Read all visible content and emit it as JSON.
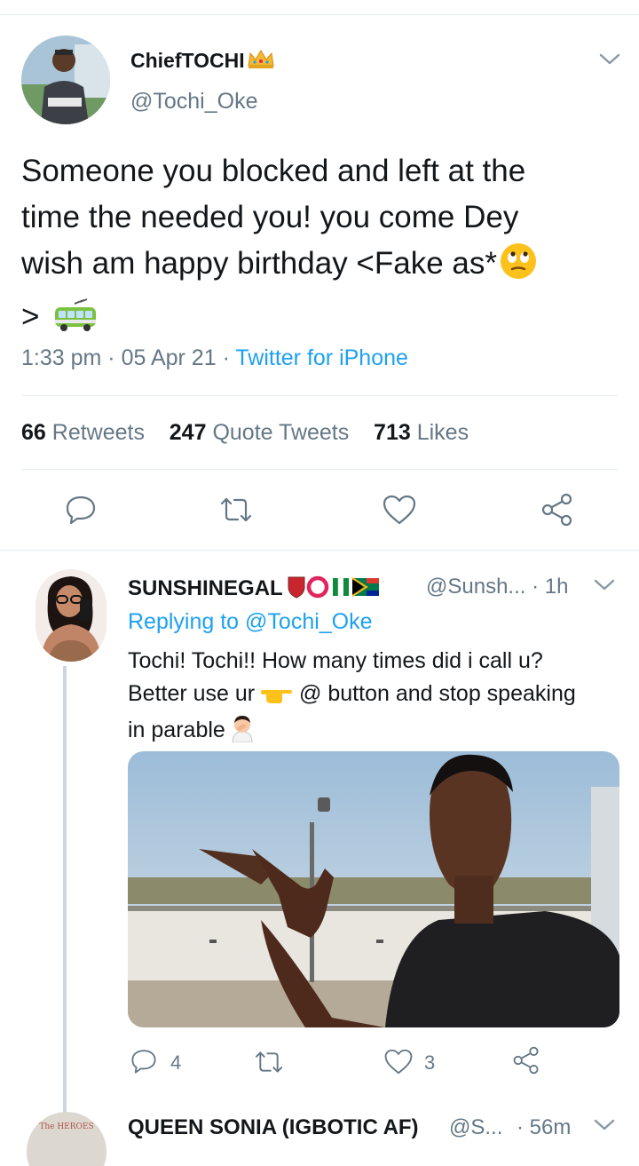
{
  "tweet": {
    "author_name": "ChiefTOCHI",
    "author_handle": "@Tochi_Oke",
    "text_line1": "Someone you blocked and left at the",
    "text_line2": "time the needed you! you come Dey",
    "text_line3": "wish am happy birthday <Fake as*",
    "text_line4": ">",
    "time": "1:33 pm",
    "date": "05 Apr 21",
    "source": "Twitter for iPhone",
    "separator": "·"
  },
  "stats": {
    "retweets_count": "66",
    "retweets_label": "Retweets",
    "quotes_count": "247",
    "quotes_label": "Quote Tweets",
    "likes_count": "713",
    "likes_label": "Likes"
  },
  "reply": {
    "author_name": "SUNSHINEGAL",
    "author_handle": "@Sunsh...",
    "time": "· 1h",
    "replying_prefix": "Replying to",
    "replying_to": "@Tochi_Oke",
    "text_line1": "Tochi! Tochi!! How many times did i call u?",
    "text_line2a": "Better use ur",
    "text_line2b": "@ button and stop speaking",
    "text_line3": "in parable",
    "reply_count": "4",
    "like_count": "3"
  },
  "next_reply": {
    "author_name": "QUEEN SONIA (IGBOTIC AF)",
    "author_handle": "@S...",
    "time": "· 56m",
    "avatar_text": "The HEROES"
  },
  "colors": {
    "link_blue": "#1da1f2",
    "secondary_gray": "#657786",
    "divider": "#e6ecf0"
  },
  "icons": [
    "chevron-down-icon",
    "crown-emoji",
    "eyes-roll-emoji",
    "bus-emoji",
    "reply-icon",
    "retweet-icon",
    "like-icon",
    "share-icon",
    "pointing-hand-emoji",
    "facepalm-emoji"
  ]
}
